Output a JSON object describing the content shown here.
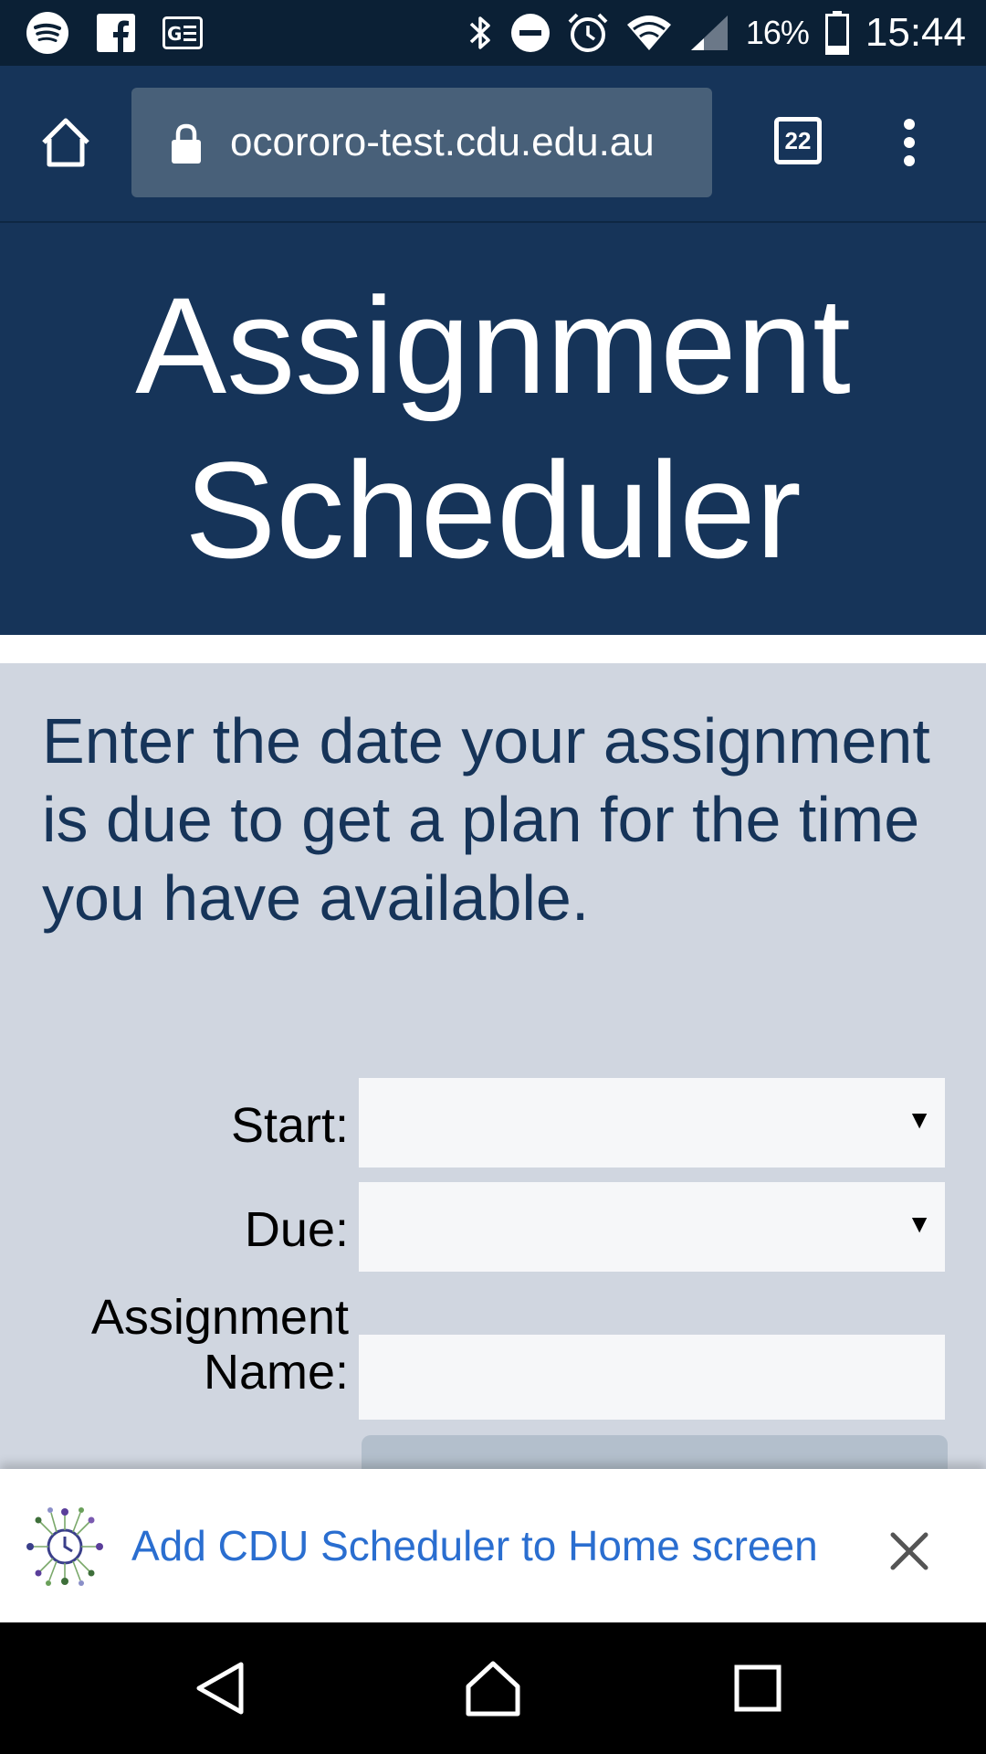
{
  "status_bar": {
    "battery": "16%",
    "time": "15:44",
    "icons": [
      "spotify-icon",
      "facebook-icon",
      "news-icon",
      "bluetooth-icon",
      "do-not-disturb-icon",
      "alarm-icon",
      "wifi-icon",
      "signal-icon",
      "battery-icon"
    ]
  },
  "browser": {
    "url": "ocororo-test.cdu.edu.au",
    "tab_count": "22"
  },
  "header": {
    "title_line1": "Assignment",
    "title_line2": "Scheduler"
  },
  "main": {
    "intro": "Enter the date your assignment is due to get a plan for the time you have available.",
    "start_label": "Start:",
    "due_label": "Due:",
    "name_label_line1": "Assignment",
    "name_label_line2": "Name:",
    "start_value": "",
    "due_value": "",
    "name_value": ""
  },
  "banner": {
    "text": "Add CDU Scheduler to Home screen"
  },
  "colors": {
    "header_bg": "#163459",
    "status_bg": "#0b2035",
    "url_box": "#486079",
    "content_bg": "#d0d6e0",
    "link_blue": "#2a6ed0"
  }
}
